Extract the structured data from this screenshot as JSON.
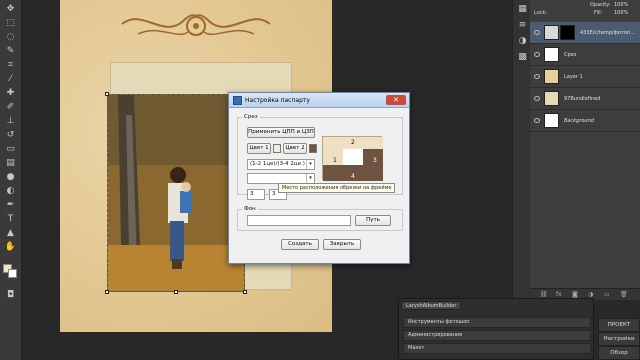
{
  "dialog": {
    "title": "Настройка паспарту",
    "close_label": "✕",
    "section_slice": "Срез",
    "apply_button": "Применить ЦПП и ЦЗП",
    "color1_button": "Цвет 1",
    "color2_button": "Цвет 2",
    "color1_hex": "#f2ecdc",
    "color2_hex": "#6e5440",
    "segments_select": "(1-2 1це)/(3-4 2це )",
    "shape_select": "",
    "size_value_1": "3",
    "size_value_2": "3",
    "tooltip": "Место расположения обрезки на фрейме",
    "preview_labels": [
      "1",
      "2",
      "3",
      "4"
    ],
    "section_background": "Фон",
    "background_path": "",
    "path_button": "Путь",
    "create_button": "Создать",
    "close_button": "Закрыть"
  },
  "layers": {
    "lock_label": "Lock:",
    "opacity_label": "Opacity:",
    "opacity_value": "100%",
    "fill_label": "Fill:",
    "fill_value": "100%",
    "items": [
      {
        "name": "433E/c/temp/фотоп...",
        "thumb": "#d9d9d9",
        "active": true
      },
      {
        "name": "Срез",
        "thumb": "#ffffff",
        "active": false
      },
      {
        "name": "Layer 1",
        "thumb": "#e7cf9d",
        "active": false
      },
      {
        "name": "97Bundlefined",
        "thumb": "#e5dab7",
        "active": false
      },
      {
        "name": "Background",
        "thumb": "#ffffff",
        "active": false
      }
    ]
  },
  "plugin": {
    "tab_label": "LaryshAlbumBuilder",
    "rows": [
      "Инструменты фотошоп",
      "Администрирование",
      "Макет"
    ]
  },
  "side_tabs": [
    "ПРОЕКТ",
    "Настройки",
    "Обзор"
  ],
  "colors": {
    "accent": "#4a5b72",
    "page": "#e7cf9d",
    "mat": "#e5dab7"
  }
}
